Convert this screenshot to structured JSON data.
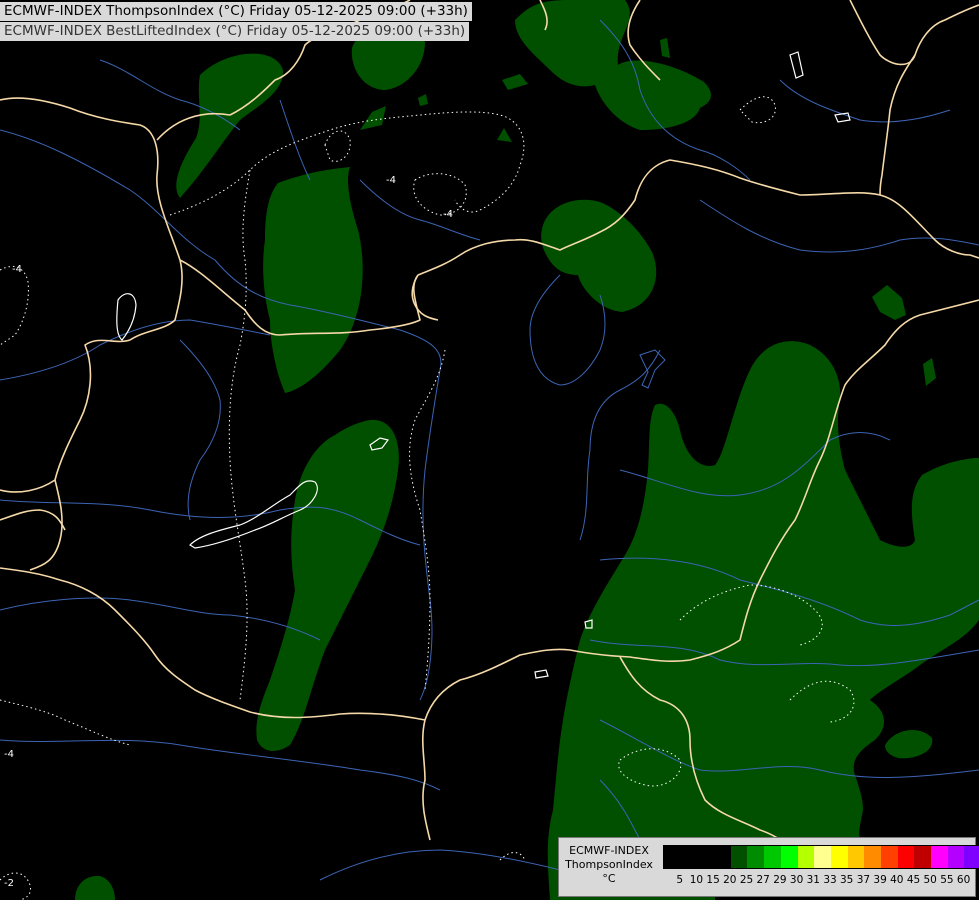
{
  "header": {
    "line1": "ECMWF-INDEX ThompsonIndex (°C) Friday 05-12-2025 09:00 (+33h)",
    "line2": "ECMWF-INDEX BestLiftedIndex (°C) Friday 05-12-2025 09:00 (+33h)"
  },
  "legend": {
    "model": "ECMWF-INDEX",
    "parameter": "ThompsonIndex",
    "unit": "°C",
    "colors": [
      "#000000",
      "#000000",
      "#000000",
      "#000000",
      "#005000",
      "#008c00",
      "#00c800",
      "#00ff00",
      "#b4ff00",
      "#ffff90",
      "#ffff00",
      "#ffc800",
      "#ff8c00",
      "#ff4000",
      "#ff0000",
      "#c00000",
      "#ff00ff",
      "#b400ff",
      "#8000ff",
      "#4000ff",
      "#0000ff"
    ],
    "ticks": [
      "5",
      "10",
      "15",
      "20",
      "25",
      "27",
      "29",
      "30",
      "31",
      "33",
      "35",
      "37",
      "39",
      "40",
      "45",
      "50",
      "55",
      "60"
    ]
  },
  "contour_labels": [
    "-4",
    "-4",
    "-4",
    "-4",
    "-2"
  ],
  "map_colors": {
    "background": "#000000",
    "thompson_fill": "#005000",
    "border": "#f5d9a8",
    "rivers": "#3c64b4",
    "li_contour": "#ffffff"
  }
}
